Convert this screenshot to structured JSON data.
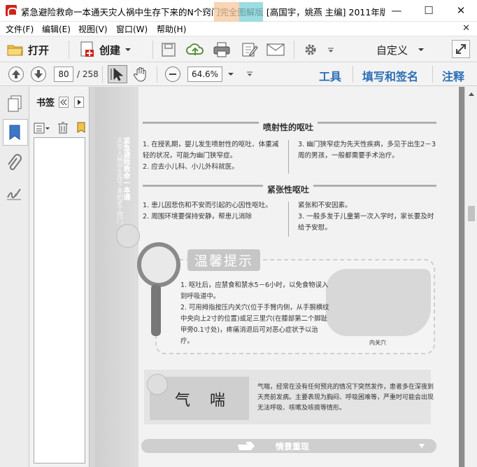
{
  "window": {
    "title": "紧急避险救命一本通天灾人祸中生存下来的N个窍门完全图解版 [高国宇，姚燕 主编] 2011年版...",
    "minimize": "—",
    "maximize": "☐",
    "close": "✕"
  },
  "menu": {
    "items": [
      "文件(F)",
      "编辑(E)",
      "视图(V)",
      "窗口(W)",
      "帮助(H)"
    ],
    "mdi_close": "✕"
  },
  "toolbar": {
    "open_label": "打开",
    "create_label": "创建",
    "custom_label": "自定义"
  },
  "navbar": {
    "current_page": "80",
    "total_pages": "/ 258",
    "zoom": "64.6%",
    "tools_label": "工具",
    "fill_sign_label": "填写和签名",
    "comment_label": "注释"
  },
  "bookmarks": {
    "title": "书签"
  },
  "page": {
    "side_vertical_1": "紧急避险救命一本通",
    "side_vertical_2": "天灾人祸中生存下来的N个窍门",
    "sec1_title": "喷射性的呕吐",
    "sec1_left": "1. 在授乳期，婴儿发生喷射性的呕吐、体重减轻的状况，可能为幽门狭窄症。\n2. 应去小儿科、小儿外科就医。",
    "sec1_right": "3. 幽门狭窄症为先天性疾病，多见于出生2－3周的男孩，一般都需要手术治疗。",
    "sec2_title": "紧张性呕吐",
    "sec2_left": "1. 患儿因悲伤和不安而引起的心因性呕吐。\n2. 周围环境要保持安静，帮患儿消除",
    "sec2_right": "紧张和不安因素。\n3. 一般多发于儿童第一次入学时，家长要及时给予安慰。",
    "tip_title": "温馨提示",
    "tip_text": "1. 呕吐后，应禁食和禁水5－6小时，以免食物误入到呼吸道中。\n2. 可用拇指按压内关穴(位于手臂内侧，从手腕横纹中央向上2寸的位置)或足三里穴(在膝部第二个脚趾甲旁0.1寸处)，疼痛消退后可对恶心症状予以治疗。",
    "hand_caption": "内关穴",
    "asthma_name": "气喘",
    "asthma_text": "气喘，经常在没有任何预兆的情况下突然发作，患者多在深夜到天亮前发病。主要表现为胸闷、呼吸困难等，严重时可能会出现无法呼吸、咳嗽及咳痰等情形。",
    "scene_title": "情景重现"
  }
}
